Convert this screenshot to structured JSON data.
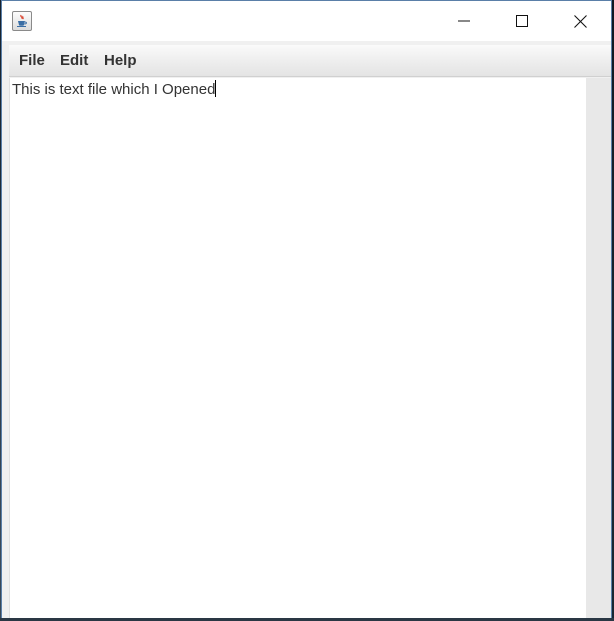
{
  "window": {
    "title": ""
  },
  "menubar": {
    "items": [
      {
        "label": "File"
      },
      {
        "label": "Edit"
      },
      {
        "label": "Help"
      }
    ]
  },
  "editor": {
    "content": "This is text file which I Opened"
  },
  "icons": {
    "app": "java-cup-icon",
    "minimize": "minimize-icon",
    "maximize": "maximize-icon",
    "close": "close-icon"
  },
  "colors": {
    "window_border": "#5a7fa8",
    "menubar_bg": "#ececec",
    "editor_bg": "#ffffff",
    "text": "#333333"
  }
}
